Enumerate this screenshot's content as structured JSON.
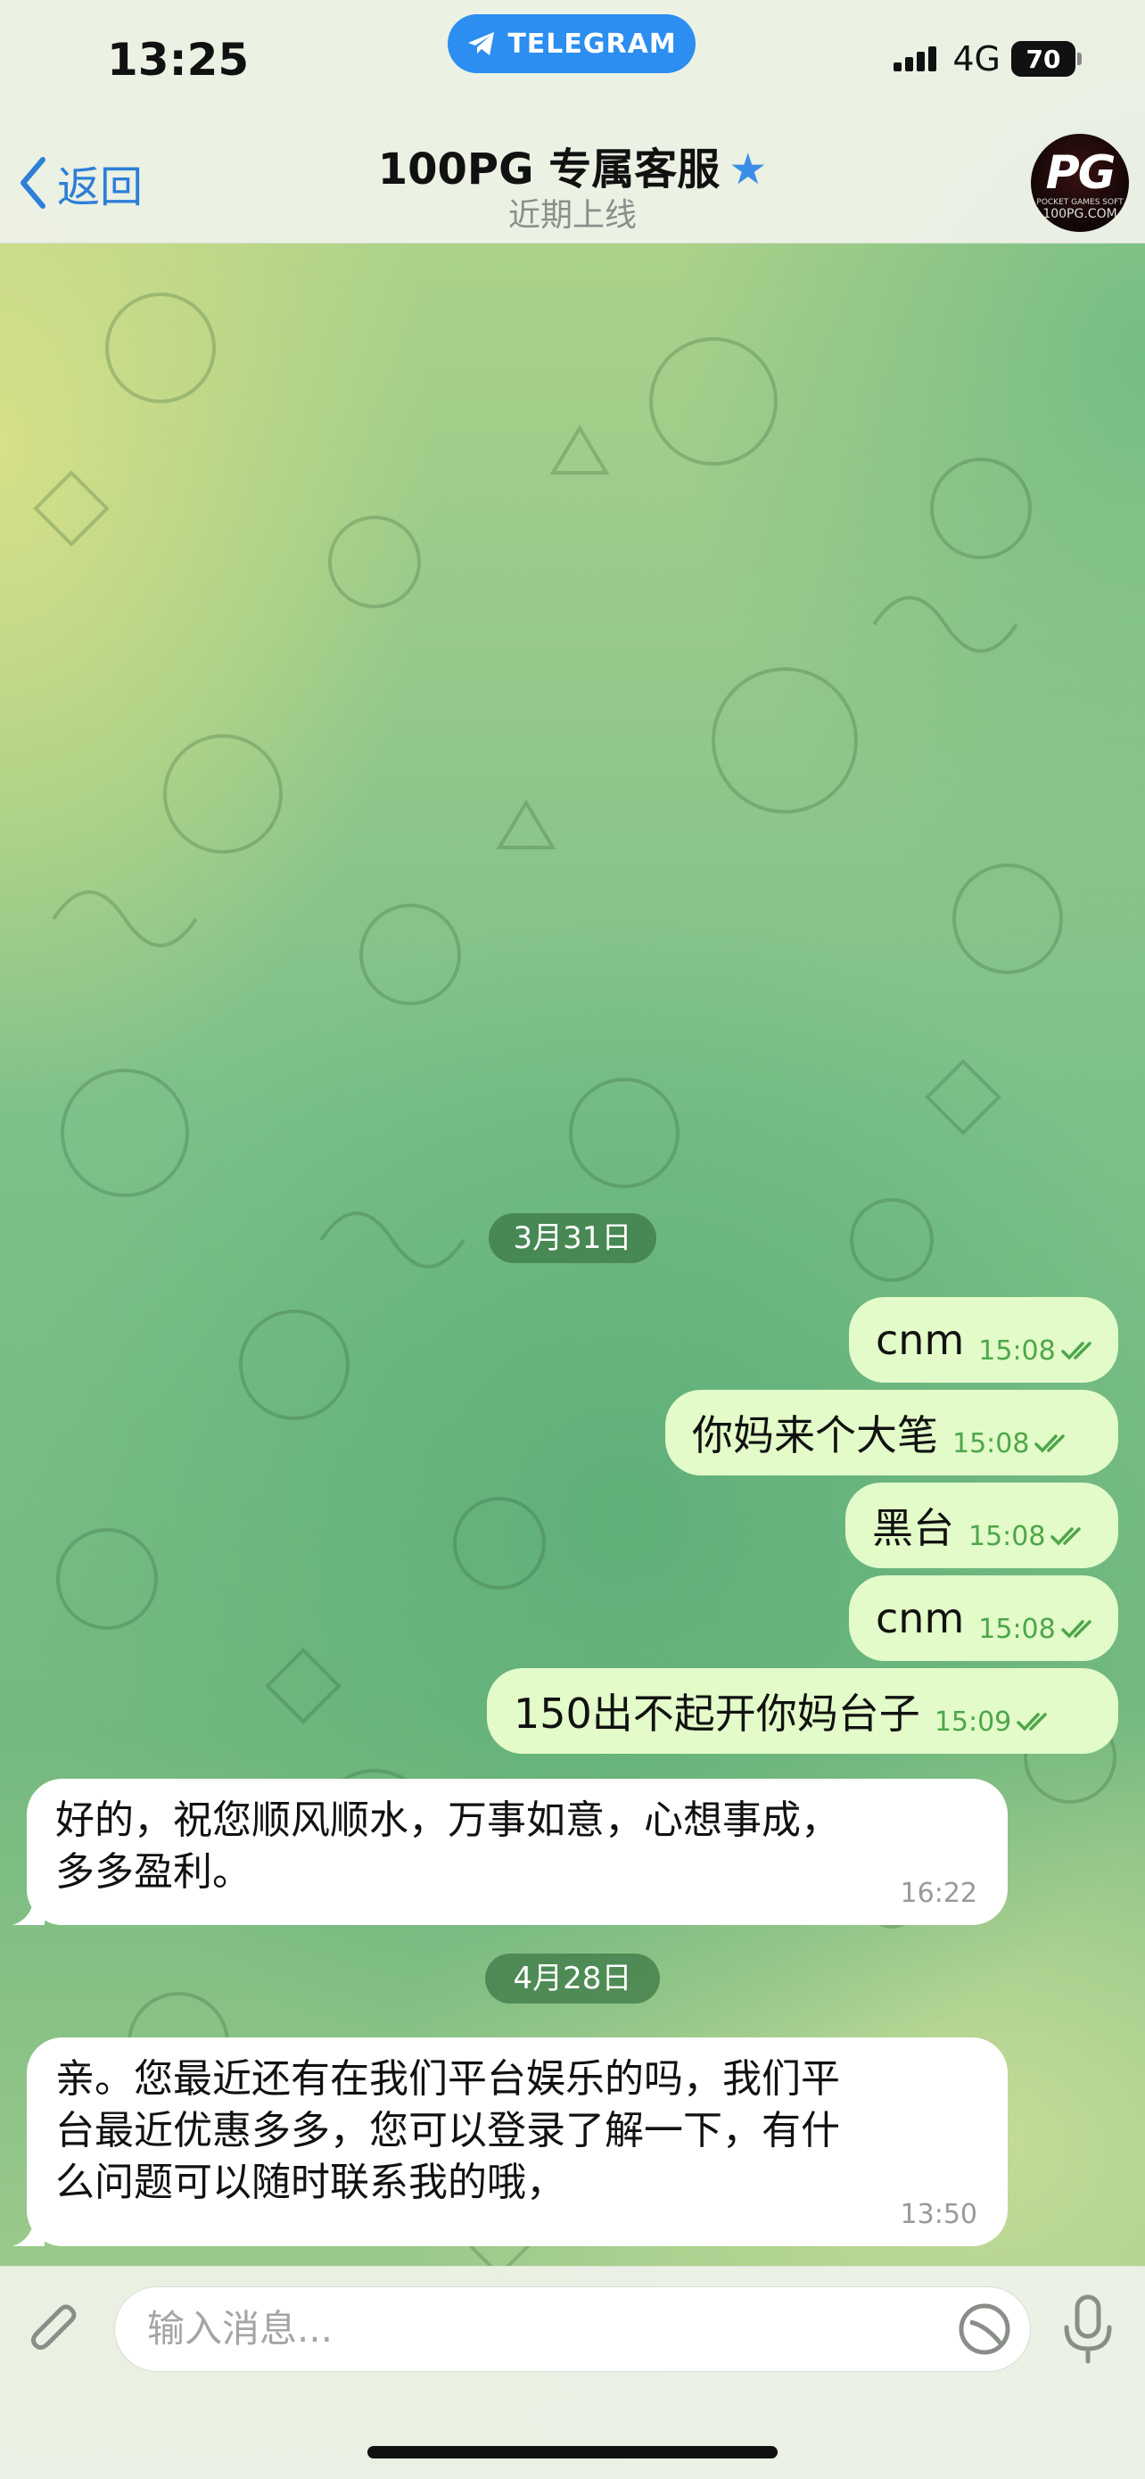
{
  "status_bar": {
    "time": "13:25",
    "app_pill": "TELEGRAM",
    "network": "4G",
    "battery": "70"
  },
  "header": {
    "back_label": "返回",
    "title": "100PG 专属客服",
    "status": "近期上线",
    "avatar_text": "PG",
    "avatar_sub": "POCKET GAMES SOFT",
    "avatar_domain": "100PG.COM"
  },
  "messages": {
    "date1": "3月31日",
    "m1": {
      "text": "cnm",
      "time": "15:08"
    },
    "m2": {
      "text": "你妈来个大笔",
      "time": "15:08"
    },
    "m3": {
      "text": "黑台",
      "time": "15:08"
    },
    "m4": {
      "text": "cnm",
      "time": "15:08"
    },
    "m5": {
      "text": "150出不起开你妈台子",
      "time": "15:09"
    },
    "m6": {
      "line1": "好的，祝您顺风顺水，万事如意，心想事成，",
      "line2": "多多盈利。",
      "time": "16:22"
    },
    "date2": "4月28日",
    "m7": {
      "line1": "亲。您最近还有在我们平台娱乐的吗，我们平",
      "line2": "台最近优惠多多，您可以登录了解一下，有什",
      "line3": "么问题可以随时联系我的哦，",
      "time": "13:50"
    }
  },
  "composer": {
    "placeholder": "输入消息..."
  },
  "colors": {
    "accent": "#2d7fd8",
    "outgoing_bubble": "#e2fbc8",
    "incoming_bubble": "#ffffff",
    "read_check": "#4ea64a"
  }
}
